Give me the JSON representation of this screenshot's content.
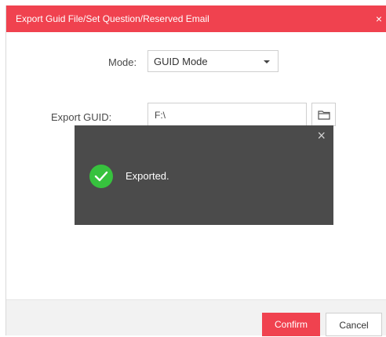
{
  "dialog": {
    "title": "Export Guid File/Set Question/Reserved Email",
    "close_glyph": "×"
  },
  "form": {
    "mode_label": "Mode:",
    "mode_value": "GUID Mode",
    "export_guid_label": "Export GUID:",
    "export_guid_value": "F:\\"
  },
  "toast": {
    "message": "Exported.",
    "close_glyph": "×",
    "status_icon": "success-check-icon",
    "status_color": "#37c23e"
  },
  "footer": {
    "confirm_label": "Confirm",
    "cancel_label": "Cancel"
  },
  "colors": {
    "accent": "#f0424f",
    "toast_bg": "#4b4b4b"
  }
}
